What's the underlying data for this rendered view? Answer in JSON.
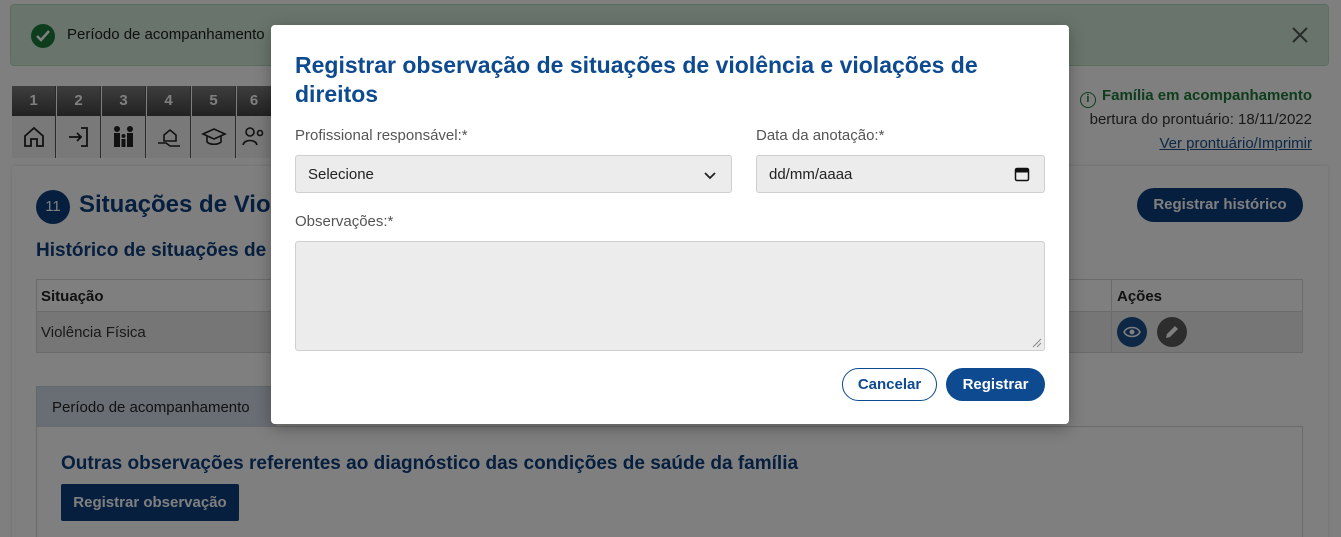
{
  "alert": {
    "text": "Período de acompanhamento",
    "close_icon": "close-icon",
    "check_icon": "check-circle-icon"
  },
  "steps": [
    {
      "number": "1",
      "icon": "home-icon"
    },
    {
      "number": "2",
      "icon": "login-icon"
    },
    {
      "number": "3",
      "icon": "family-icon"
    },
    {
      "number": "4",
      "icon": "hand-house-icon"
    },
    {
      "number": "5",
      "icon": "graduation-cap-icon"
    },
    {
      "number": "6",
      "icon": "people-gear-icon"
    }
  ],
  "header": {
    "status": "Família em acompanhamento",
    "opening": "bertura do prontuário: 18/11/2022",
    "view_link": "Ver prontuário/Imprimir"
  },
  "section": {
    "badge": "11",
    "title": "Situações de Viol",
    "history_button": "Registrar histórico",
    "history_title": "Histórico de situações de"
  },
  "table": {
    "headers": {
      "situacao": "Situação",
      "acoes": "Ações"
    },
    "rows": [
      {
        "situacao": "Violência Física"
      }
    ]
  },
  "period_tab": "Período de acompanhamento",
  "observations": {
    "title": "Outras observações referentes ao diagnóstico das condições de saúde da família",
    "button": "Registrar observação"
  },
  "modal": {
    "title": "Registrar observação de situações de violência e violações de direitos",
    "professional_label": "Profissional responsável:*",
    "professional_value": "Selecione",
    "date_label": "Data da anotação:*",
    "date_placeholder": "dd/mm/aaaa",
    "observations_label": "Observações:*",
    "observations_value": "",
    "cancel": "Cancelar",
    "submit": "Registrar"
  },
  "colors": {
    "primary": "#0d4a8f",
    "success": "#1c7a3b",
    "alert_bg": "#d3ead8"
  }
}
